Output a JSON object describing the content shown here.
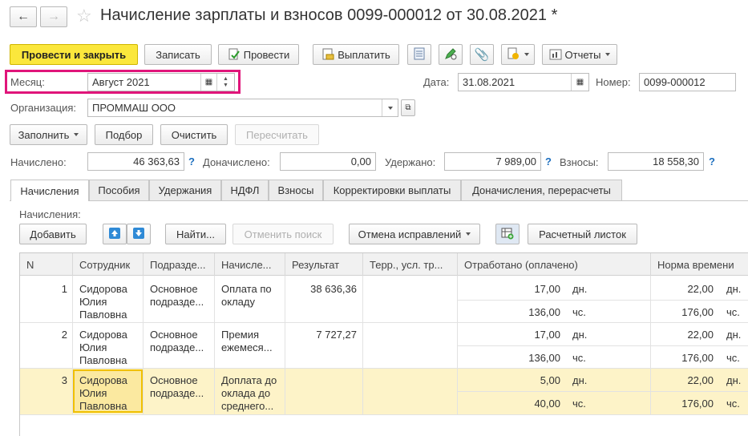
{
  "window": {
    "title": "Начисление зарплаты и взносов 0099-000012 от 30.08.2021 *"
  },
  "toolbar": {
    "post_close": "Провести и закрыть",
    "save": "Записать",
    "post": "Провести",
    "pay": "Выплатить",
    "reports": "Отчеты"
  },
  "header": {
    "month_label": "Месяц:",
    "month_value": "Август 2021",
    "date_label": "Дата:",
    "date_value": "31.08.2021",
    "number_label": "Номер:",
    "number_value": "0099-000012",
    "org_label": "Организация:",
    "org_value": "ПРОММАШ ООО"
  },
  "actions": {
    "fill": "Заполнить",
    "select": "Подбор",
    "clear": "Очистить",
    "recalc": "Пересчитать"
  },
  "totals": {
    "accrued_label": "Начислено:",
    "accrued_value": "46 363,63",
    "extra_label": "Доначислено:",
    "extra_value": "0,00",
    "withheld_label": "Удержано:",
    "withheld_value": "7 989,00",
    "contrib_label": "Взносы:",
    "contrib_value": "18 558,30",
    "help": "?"
  },
  "tabs": [
    "Начисления",
    "Пособия",
    "Удержания",
    "НДФЛ",
    "Взносы",
    "Корректировки выплаты",
    "Доначисления, перерасчеты"
  ],
  "section": {
    "title": "Начисления:",
    "add": "Добавить",
    "find": "Найти...",
    "cancel_search": "Отменить поиск",
    "cancel_fix": "Отмена исправлений",
    "payslip": "Расчетный листок"
  },
  "grid": {
    "columns": [
      "N",
      "Сотрудник",
      "Подразде...",
      "Начисле...",
      "Результат",
      "Терр., усл. тр...",
      "Отработано (оплачено)",
      "Норма времени"
    ],
    "rows": [
      {
        "n": "1",
        "employee": "Сидорова\nЮлия\nПавловна",
        "dept": "Основное\nподразде...",
        "accrual": "Оплата по\nокладу",
        "result": "38 636,36",
        "worked_days": "17,00",
        "days_unit": "дн.",
        "worked_hours": "136,00",
        "hours_unit": "чс.",
        "norm_days": "22,00",
        "norm_days_unit": "дн.",
        "norm_hours": "176,00",
        "norm_hours_unit": "чс."
      },
      {
        "n": "2",
        "employee": "Сидорова\nЮлия\nПавловна",
        "dept": "Основное\nподразде...",
        "accrual": "Премия\nежемеся...",
        "result": "7 727,27",
        "worked_days": "17,00",
        "days_unit": "дн.",
        "worked_hours": "136,00",
        "hours_unit": "чс.",
        "norm_days": "22,00",
        "norm_days_unit": "дн.",
        "norm_hours": "176,00",
        "norm_hours_unit": "чс."
      },
      {
        "n": "3",
        "employee": "Сидорова\nЮлия\nПавловна",
        "dept": "Основное\nподразде...",
        "accrual": "Доплата до\nоклада до\nсреднего...",
        "result": "",
        "worked_days": "5,00",
        "days_unit": "дн.",
        "worked_hours": "40,00",
        "hours_unit": "чс.",
        "norm_days": "22,00",
        "norm_days_unit": "дн.",
        "norm_hours": "176,00",
        "norm_hours_unit": "чс."
      }
    ]
  },
  "colors": {
    "primary_button": "#fbe73c",
    "highlight_frame": "#e0157a",
    "selected_row": "#fdf3c8",
    "selected_cell_border": "#f0c000",
    "help_blue": "#1d6fbf"
  }
}
